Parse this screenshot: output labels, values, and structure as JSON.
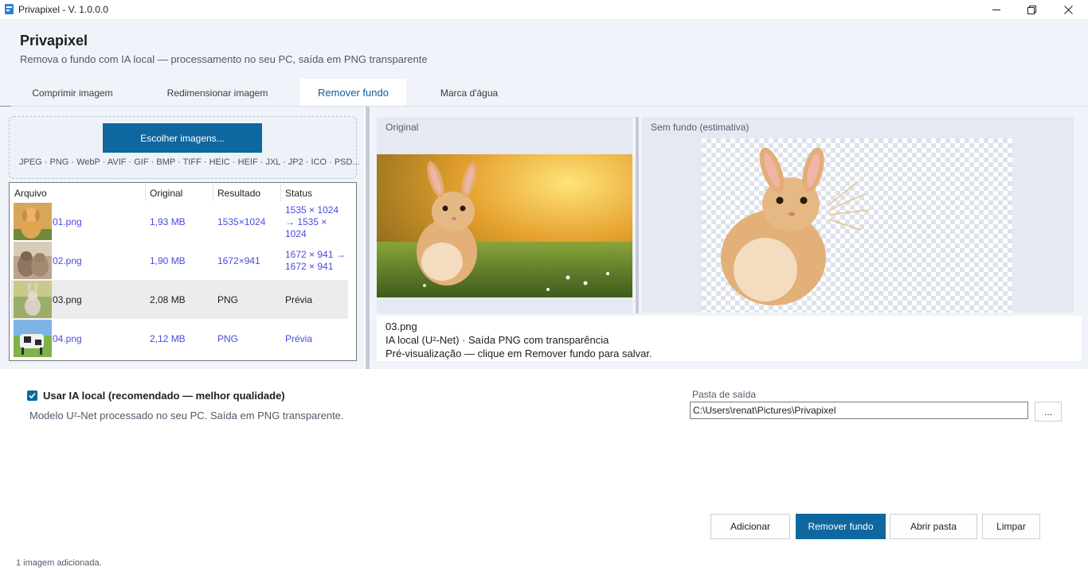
{
  "window": {
    "title": "Privapixel - V. 1.0.0.0",
    "icon": "app-logo-icon",
    "controls": [
      "minimize-icon",
      "maximize-icon",
      "close-icon"
    ]
  },
  "header": {
    "app_name": "Privapixel",
    "subtitle": "Remova o fundo com IA local — processamento no seu PC, saída em PNG transparente",
    "tabs": [
      {
        "label": "Comprimir imagem",
        "active": false
      },
      {
        "label": "Redimensionar imagem",
        "active": false
      },
      {
        "label": "Remover fundo",
        "active": true
      },
      {
        "label": "Marca d'água",
        "active": false
      }
    ]
  },
  "dropzone": {
    "button_label": "Escolher imagens...",
    "formats": "JPEG · PNG · WebP · AVIF · GIF · BMP · TIFF · HEIC · HEIF · JXL · JP2 · ICO · PSD..."
  },
  "table": {
    "columns": [
      "Arquivo",
      "Original",
      "Resultado",
      "Status"
    ],
    "rows": [
      {
        "file": "01.png",
        "original": "1,93 MB",
        "result": "1535×1024",
        "status": "1535 × 1024 → 1535 × 1024",
        "status_lines": [
          "1535 × 1024",
          "→ 1535 ×",
          "1024"
        ],
        "selected": false
      },
      {
        "file": "02.png",
        "original": "1,90 MB",
        "result": "1672×941",
        "status": "1672 × 941 → 1672 × 941",
        "status_lines": [
          "1672 × 941 →",
          "1672 × 941"
        ],
        "selected": false
      },
      {
        "file": "03.png",
        "original": "2,08 MB",
        "result": "PNG",
        "status": "Prévia",
        "status_lines": [
          "Prévia"
        ],
        "selected": true
      },
      {
        "file": "04.png",
        "original": "2,12 MB",
        "result": "PNG",
        "status": "Prévia",
        "status_lines": [
          "Prévia"
        ],
        "selected": false
      }
    ]
  },
  "preview": {
    "original_label": "Original",
    "result_label": "Sem fundo (estimativa)",
    "info": [
      "03.png",
      "IA local (U²-Net) · Saída PNG com transparência",
      "Pré-visualização — clique em Remover fundo para salvar."
    ]
  },
  "options": {
    "use_ai_label": "Usar IA local (recomendado — melhor qualidade)",
    "use_ai_checked": true,
    "use_ai_desc": "Modelo U²-Net processado no seu PC. Saída em PNG transparente.",
    "output_folder_label": "Pasta de saída",
    "output_folder_value": "C:\\Users\\renat\\Pictures\\Privapixel",
    "browse_label": "..."
  },
  "actions": {
    "add": "Adicionar",
    "remove_bg": "Remover fundo",
    "open_folder": "Abrir pasta",
    "clear": "Limpar"
  },
  "status": "1 imagem adicionada.",
  "colors": {
    "accent": "#0f679f",
    "panel_bg": "#f0f3f9",
    "link": "#4a4ae0"
  }
}
